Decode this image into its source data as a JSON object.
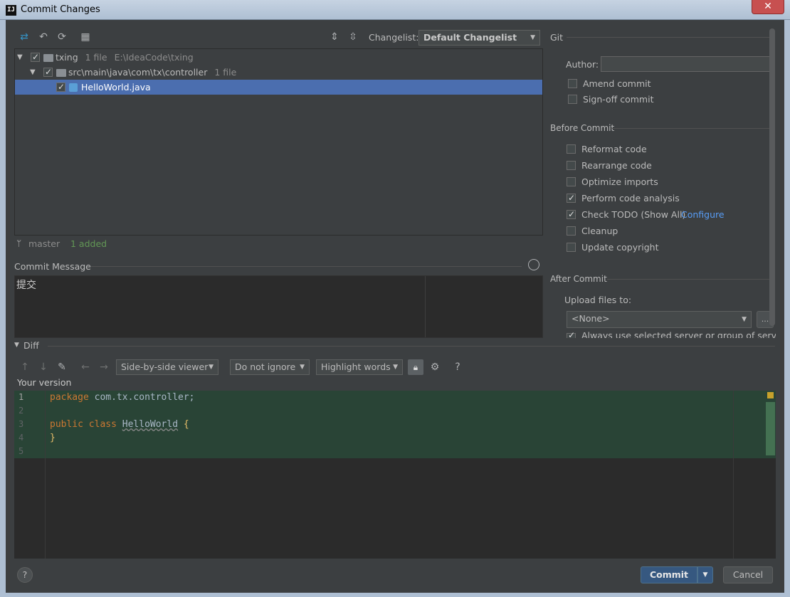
{
  "window": {
    "title": "Commit Changes",
    "app_icon": "IJ",
    "close_glyph": "✕"
  },
  "toolbar": {
    "changelist_label": "Changelist:",
    "changelist_value": "Default Changelist"
  },
  "tree": {
    "root": {
      "name": "txing",
      "count": "1 file",
      "path": "E:\\IdeaCode\\txing"
    },
    "dir": {
      "name": "src\\main\\java\\com\\tx\\controller",
      "count": "1 file"
    },
    "file": {
      "name": "HelloWorld.java"
    }
  },
  "status": {
    "branch": "master",
    "added": "1 added"
  },
  "commit_message": {
    "label": "Commit Message",
    "text": "提交"
  },
  "git": {
    "section": "Git",
    "author_label": "Author:",
    "author_value": "",
    "amend": "Amend commit",
    "signoff": "Sign-off commit"
  },
  "before_commit": {
    "section": "Before Commit",
    "items": [
      {
        "label": "Reformat code",
        "checked": false
      },
      {
        "label": "Rearrange code",
        "checked": false
      },
      {
        "label": "Optimize imports",
        "checked": false
      },
      {
        "label": "Perform code analysis",
        "checked": true
      },
      {
        "label": "Check TODO (Show All)",
        "checked": true,
        "link": "Configure"
      },
      {
        "label": "Cleanup",
        "checked": false
      },
      {
        "label": "Update copyright",
        "checked": false
      }
    ]
  },
  "after_commit": {
    "section": "After Commit",
    "upload_label": "Upload files to:",
    "upload_value": "<None>",
    "more_button": "...",
    "cut_off_text": "Always use selected server or group of servers"
  },
  "diff": {
    "section": "Diff",
    "viewer": "Side-by-side viewer",
    "ignore": "Do not ignore",
    "highlight": "Highlight words",
    "help": "?",
    "your_version": "Your version",
    "lines": [
      {
        "n": "1",
        "code": "package com.tx.controller;"
      },
      {
        "n": "2",
        "code": ""
      },
      {
        "n": "3",
        "code": "public class HelloWorld {"
      },
      {
        "n": "4",
        "code": "}"
      },
      {
        "n": "5",
        "code": ""
      }
    ]
  },
  "footer": {
    "help": "?",
    "commit": "Commit",
    "cancel": "Cancel"
  },
  "colors": {
    "background": "#3c3f41",
    "selection": "#4b6eaf",
    "added_bg": "#294436",
    "link": "#589df6",
    "added_text": "#629755"
  }
}
